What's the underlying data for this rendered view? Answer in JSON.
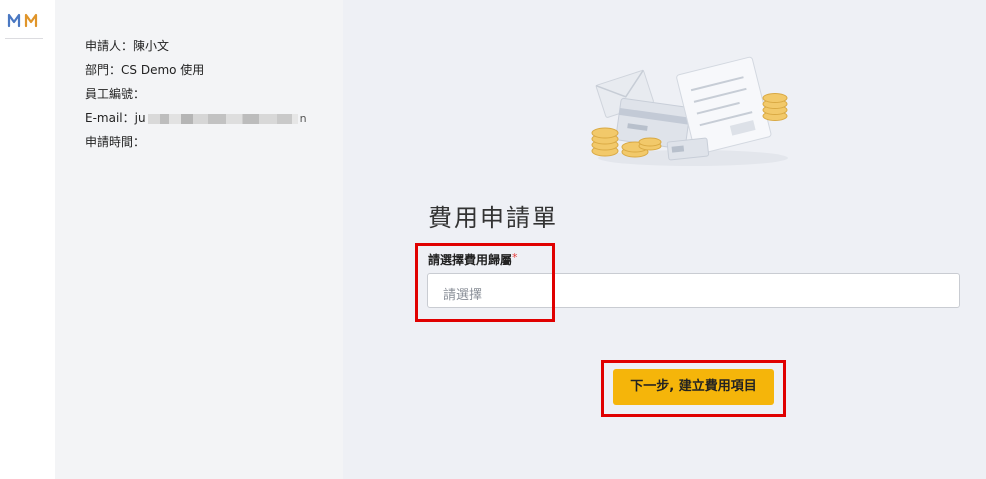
{
  "logo": {
    "icon": "mm-logo-icon",
    "colors": {
      "m1": "#4a78c2",
      "m2": "#e0952a"
    }
  },
  "info": {
    "applicant_label": "申請人：",
    "applicant_value": "陳小文",
    "dept_label": "部門：",
    "dept_value": "CS Demo 使用",
    "employee_id_label": "員工編號：",
    "email_label": "E-mail：",
    "email_prefix": "ju",
    "email_suffix": "n",
    "apply_time_label": "申請時間："
  },
  "form": {
    "title": "費用申請單",
    "field_label": "請選擇費用歸屬",
    "required_mark": "*",
    "select_placeholder": "請選擇",
    "next_button": "下一步, 建立費用項目"
  },
  "colors": {
    "accent": "#f5b50a",
    "highlight": "#e00000",
    "panel_bg": "#f3f4f6",
    "main_bg": "#eef0f5"
  }
}
